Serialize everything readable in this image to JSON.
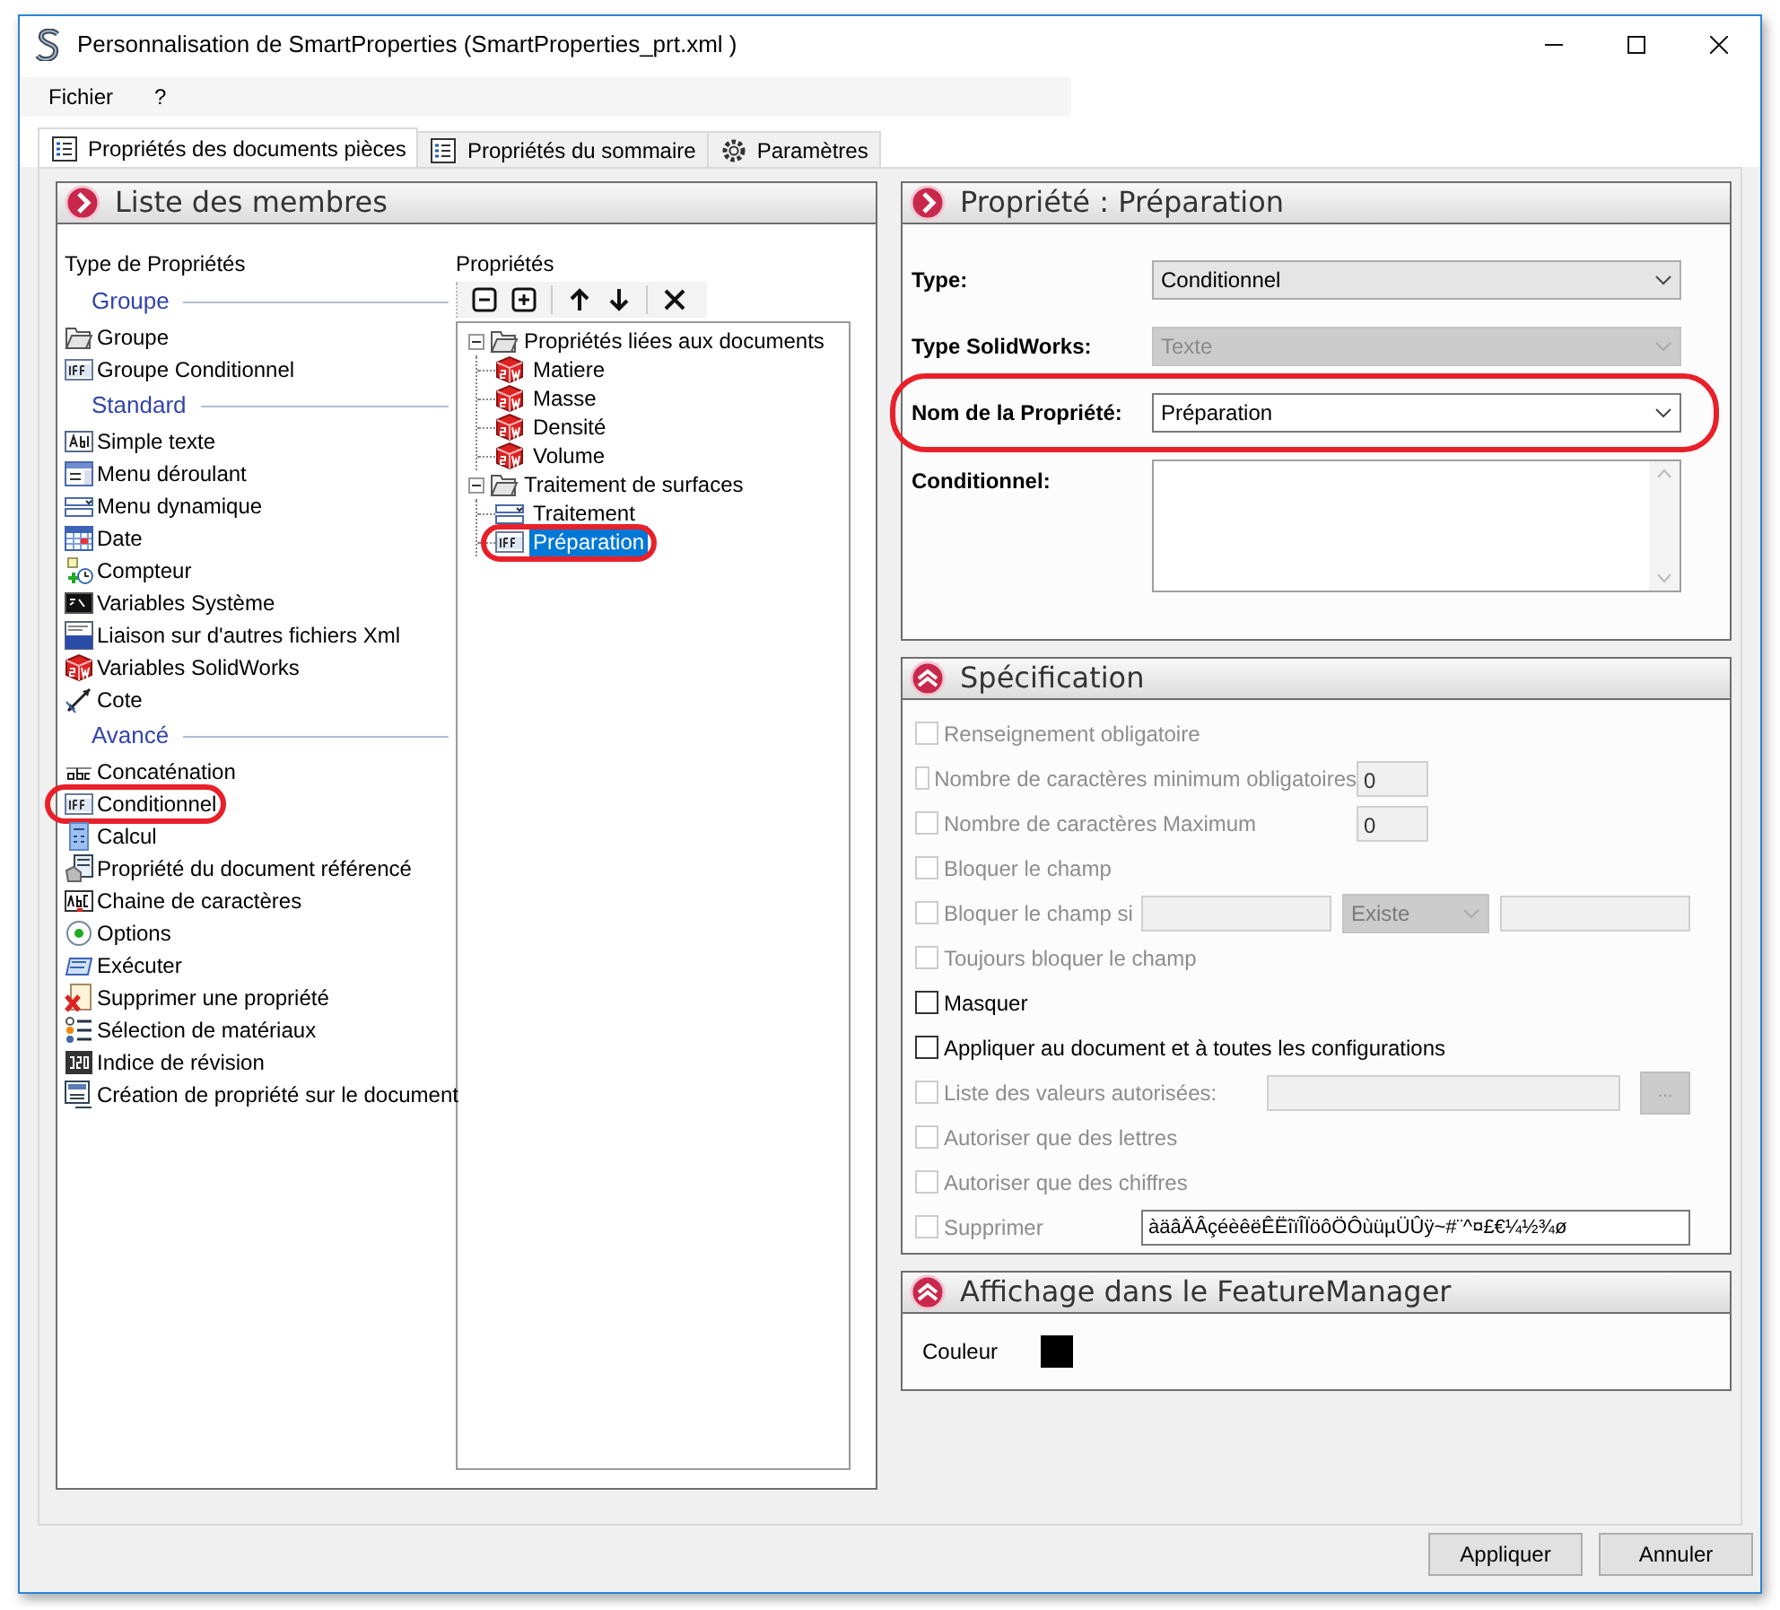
{
  "window": {
    "title": "Personnalisation de SmartProperties (SmartProperties_prt.xml )"
  },
  "menu": [
    "Fichier",
    "?"
  ],
  "tabs": [
    {
      "label": "Propriétés des documents pièces",
      "kind": "list",
      "selected": true
    },
    {
      "label": "Propriétés du sommaire",
      "kind": "list",
      "selected": false
    },
    {
      "label": "Paramètres",
      "kind": "gear",
      "selected": false
    }
  ],
  "members_panel": {
    "title": "Liste des membres",
    "types": {
      "heading": "Type de Propriétés",
      "sections": [
        {
          "title": "Groupe",
          "items": [
            {
              "label": "Groupe",
              "kind": "folder",
              "circled": false
            },
            {
              "label": "Groupe Conditionnel",
              "kind": "iff",
              "circled": false
            }
          ]
        },
        {
          "title": "Standard",
          "items": [
            {
              "label": "Simple texte",
              "kind": "text",
              "circled": false
            },
            {
              "label": "Menu déroulant",
              "kind": "dropdown",
              "circled": false
            },
            {
              "label": "Menu dynamique",
              "kind": "dynamic",
              "circled": false
            },
            {
              "label": "Date",
              "kind": "date",
              "circled": false
            },
            {
              "label": "Compteur",
              "kind": "counter",
              "circled": false
            },
            {
              "label": "Variables Système",
              "kind": "console",
              "circled": false
            },
            {
              "label": "Liaison sur d'autres fichiers Xml",
              "kind": "xml",
              "circled": false
            },
            {
              "label": "Variables SolidWorks",
              "kind": "sw",
              "circled": false
            },
            {
              "label": "Cote",
              "kind": "dimension",
              "circled": false
            }
          ]
        },
        {
          "title": "Avancé",
          "items": [
            {
              "label": "Concaténation",
              "kind": "concat",
              "circled": false
            },
            {
              "label": "Conditionnel",
              "kind": "iff",
              "circled": true
            },
            {
              "label": "Calcul",
              "kind": "calc",
              "circled": false
            },
            {
              "label": "Propriété du document référencé",
              "kind": "reference",
              "circled": false
            },
            {
              "label": "Chaine de caractères",
              "kind": "string",
              "circled": false
            },
            {
              "label": "Options",
              "kind": "option",
              "circled": false
            },
            {
              "label": "Exécuter",
              "kind": "execute",
              "circled": false
            },
            {
              "label": "Supprimer une propriété",
              "kind": "delete",
              "circled": false
            },
            {
              "label": "Sélection de matériaux",
              "kind": "materials",
              "circled": false
            },
            {
              "label": "Indice de révision",
              "kind": "revision",
              "circled": false
            },
            {
              "label": "Création de propriété sur le document",
              "kind": "create",
              "circled": false
            }
          ]
        }
      ]
    },
    "properties": {
      "heading": "Propriétés",
      "tree": [
        {
          "label": "Propriétés liées aux documents",
          "kind": "folder",
          "expanded": true,
          "children": [
            {
              "label": "Matiere",
              "kind": "sw",
              "selected": false,
              "circled": false
            },
            {
              "label": "Masse",
              "kind": "sw",
              "selected": false,
              "circled": false
            },
            {
              "label": "Densité",
              "kind": "sw",
              "selected": false,
              "circled": false
            },
            {
              "label": "Volume",
              "kind": "sw",
              "selected": false,
              "circled": false
            }
          ]
        },
        {
          "label": "Traitement de surfaces",
          "kind": "folder",
          "expanded": true,
          "children": [
            {
              "label": "Traitement",
              "kind": "dynamic",
              "selected": false,
              "circled": false
            },
            {
              "label": "Préparation",
              "kind": "iff",
              "selected": true,
              "circled": true
            }
          ]
        }
      ]
    }
  },
  "property_panel": {
    "title": "Propriété : Préparation",
    "fields": [
      {
        "label": "Type:",
        "kind": "dropdown",
        "value": "Conditionnel",
        "disabled": false,
        "circled": false
      },
      {
        "label": "Type SolidWorks:",
        "kind": "dropdown",
        "value": "Texte",
        "disabled": true,
        "circled": false
      },
      {
        "label": "Nom de la Propriété:",
        "kind": "combo",
        "value": "Préparation",
        "disabled": false,
        "circled": true
      },
      {
        "label": "Conditionnel:",
        "kind": "textarea",
        "disabled": false,
        "circled": false
      }
    ]
  },
  "specification_panel": {
    "title": "Spécification",
    "rows": [
      {
        "label": "Renseignement obligatoire",
        "disabled": true,
        "checked": false,
        "controls": []
      },
      {
        "label": "Nombre de caractères minimum obligatoires",
        "disabled": true,
        "checked": false,
        "controls": [
          {
            "kind": "number",
            "value": "0",
            "disabled": true
          }
        ]
      },
      {
        "label": "Nombre de caractères Maximum",
        "disabled": true,
        "checked": false,
        "controls": [
          {
            "kind": "number",
            "value": "0",
            "disabled": true
          }
        ]
      },
      {
        "label": "Bloquer le champ",
        "disabled": true,
        "checked": false,
        "controls": []
      },
      {
        "label": "Bloquer le champ si",
        "disabled": true,
        "checked": false,
        "controls": [
          {
            "kind": "input",
            "disabled": true
          },
          {
            "kind": "dropdown",
            "value": "Existe",
            "disabled": true
          },
          {
            "kind": "input",
            "disabled": true
          }
        ]
      },
      {
        "label": "Toujours bloquer le champ",
        "disabled": true,
        "checked": false,
        "controls": []
      },
      {
        "label": "Masquer",
        "disabled": false,
        "checked": false,
        "controls": []
      },
      {
        "label": "Appliquer au document et à toutes les configurations",
        "disabled": false,
        "checked": false,
        "controls": []
      },
      {
        "label": "Liste des valeurs autorisées:",
        "disabled": true,
        "checked": false,
        "controls": [
          {
            "kind": "values",
            "disabled": true
          },
          {
            "kind": "browse",
            "label": "...",
            "disabled": true
          }
        ]
      },
      {
        "label": "Autoriser que des lettres",
        "disabled": true,
        "checked": false,
        "controls": []
      },
      {
        "label": "Autoriser que des chiffres",
        "disabled": true,
        "checked": false,
        "controls": []
      },
      {
        "label": "Supprimer",
        "disabled": true,
        "checked": false,
        "controls": [
          {
            "kind": "input",
            "value": "àäâÄÂçéèêëÊËîïÎÏöôÖÔùüµÜÛÿ~#¨^¤£€¼½¾ø",
            "disabled": false
          }
        ]
      }
    ]
  },
  "display_panel": {
    "title": "Affichage dans le FeatureManager",
    "color_label": "Couleur",
    "color": "#000000"
  },
  "buttons": [
    "Appliquer",
    "Annuler"
  ]
}
